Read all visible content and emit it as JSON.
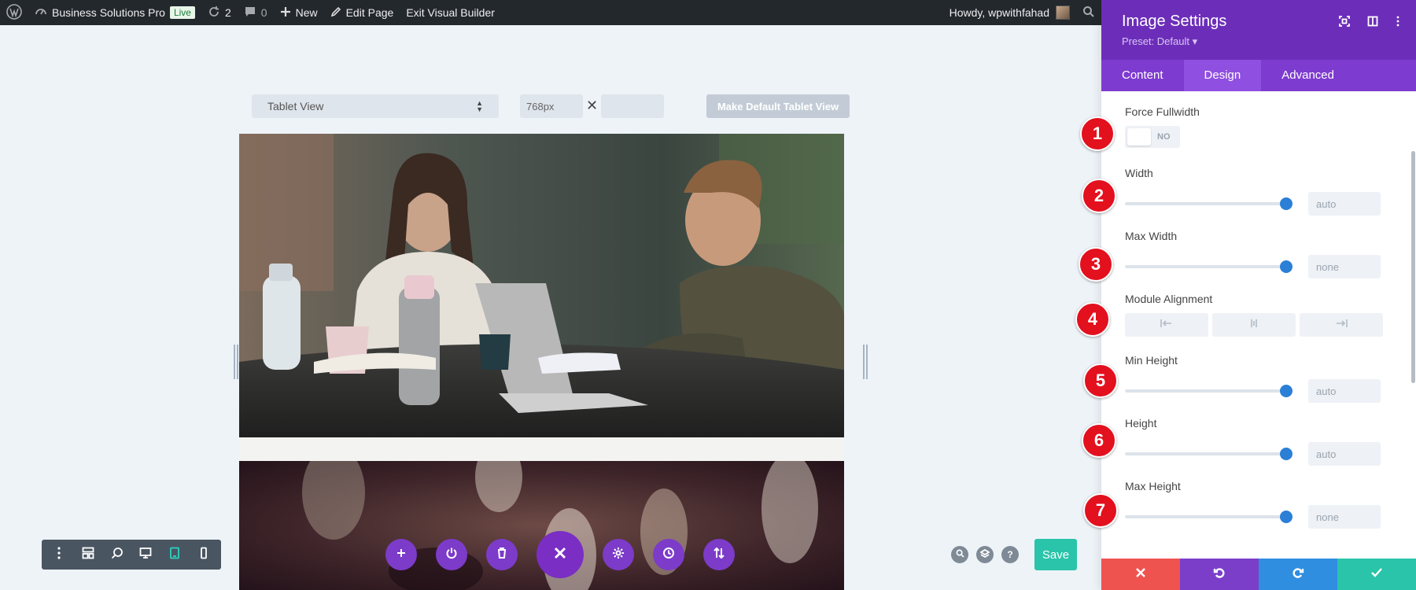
{
  "admin_bar": {
    "site_name": "Business Solutions Pro",
    "live_label": "Live",
    "updates_count": "2",
    "comments_count": "0",
    "new_label": "New",
    "edit_page_label": "Edit Page",
    "exit_builder_label": "Exit Visual Builder",
    "howdy_label": "Howdy, wpwithfahad"
  },
  "canvas": {
    "view_select": "Tablet View",
    "width_value": "768px",
    "height_value": "",
    "make_default_label": "Make Default Tablet View"
  },
  "bottom_bar": {
    "save_label": "Save",
    "help_label": "?"
  },
  "panel": {
    "title": "Image Settings",
    "preset": "Preset: Default ▾",
    "tabs": [
      "Content",
      "Design",
      "Advanced"
    ],
    "active_tab": "Design",
    "fields": [
      {
        "label": "Force Fullwidth",
        "value": "NO"
      },
      {
        "label": "Width",
        "value": "auto",
        "level": 1.0
      },
      {
        "label": "Max Width",
        "value": "none",
        "level": 1.0
      },
      {
        "label": "Module Alignment"
      },
      {
        "label": "Min Height",
        "value": "auto",
        "level": 1.0
      },
      {
        "label": "Height",
        "value": "auto",
        "level": 1.0
      },
      {
        "label": "Max Height",
        "value": "none",
        "level": 1.0
      }
    ],
    "badges": [
      "1",
      "2",
      "3",
      "4",
      "5",
      "6",
      "7"
    ]
  },
  "colors": {
    "panel_header": "#6c2eb9",
    "tabs_bar": "#7e3bd0",
    "badge": "#e3101e",
    "slider_thumb": "#2b7fd6",
    "footer_cancel": "#ef5350",
    "footer_undo": "#7b3ec9",
    "footer_redo": "#2f8ee0",
    "footer_confirm": "#29c4a9",
    "save": "#29c4a9"
  },
  "icons": [
    "wordpress-icon",
    "dashboard-icon",
    "updates-icon",
    "comments-icon",
    "plus-icon",
    "pencil-icon",
    "search-icon",
    "focus-icon",
    "split-icon",
    "kebab-icon"
  ]
}
